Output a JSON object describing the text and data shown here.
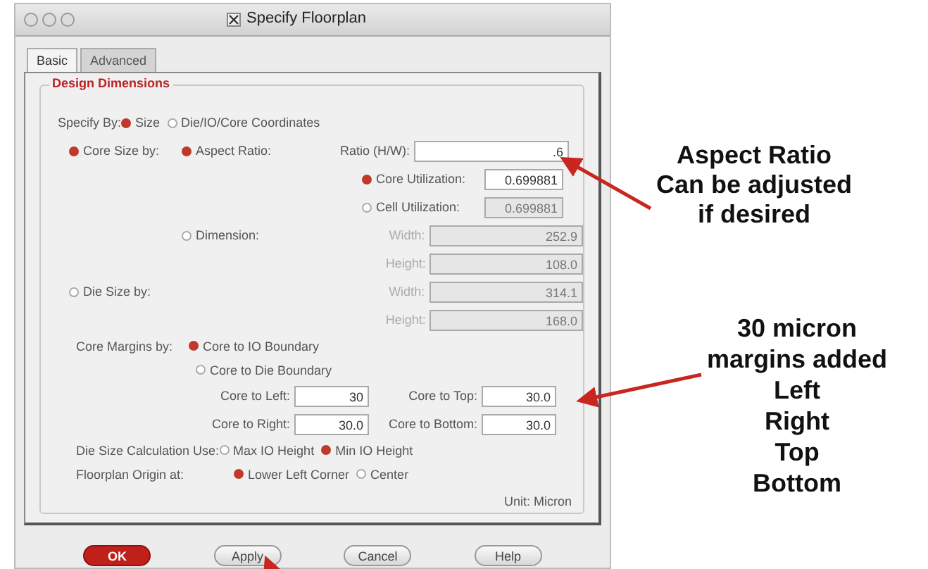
{
  "window": {
    "title": "Specify Floorplan"
  },
  "tabs": [
    {
      "label": "Basic",
      "selected": true
    },
    {
      "label": "Advanced",
      "selected": false
    }
  ],
  "group_title": "Design Dimensions",
  "specify_by": {
    "label": "Specify By:",
    "options": [
      {
        "label": "Size",
        "selected": true
      },
      {
        "label": "Die/IO/Core Coordinates",
        "selected": false
      }
    ]
  },
  "size_modes": [
    {
      "label": "Core Size by:",
      "selected": true
    },
    {
      "label": "Die Size by:",
      "selected": false
    }
  ],
  "core_modes": [
    {
      "label": "Aspect Ratio:",
      "selected": true
    },
    {
      "label": "Dimension:",
      "selected": false
    }
  ],
  "ratio": {
    "label": "Ratio (H/W):",
    "value": ".6"
  },
  "utilization": [
    {
      "label": "Core Utilization:",
      "value": "0.699881",
      "selected": true,
      "disabled": false
    },
    {
      "label": "Cell Utilization:",
      "value": "0.699881",
      "selected": false,
      "disabled": true
    }
  ],
  "core_dims": [
    {
      "label": "Width:",
      "value": "252.9",
      "disabled": true
    },
    {
      "label": "Height:",
      "value": "108.0",
      "disabled": true
    }
  ],
  "die_dims": [
    {
      "label": "Width:",
      "value": "314.1",
      "disabled": true
    },
    {
      "label": "Height:",
      "value": "168.0",
      "disabled": true
    }
  ],
  "core_margins": {
    "label": "Core Margins by:",
    "options": [
      {
        "label": "Core to IO Boundary",
        "selected": true
      },
      {
        "label": "Core to Die Boundary",
        "selected": false
      }
    ]
  },
  "margins": [
    {
      "label": "Core to Left:",
      "value": "30"
    },
    {
      "label": "Core to Top:",
      "value": "30.0"
    },
    {
      "label": "Core to Right:",
      "value": "30.0"
    },
    {
      "label": "Core to Bottom:",
      "value": "30.0"
    }
  ],
  "die_calc": {
    "label": "Die Size Calculation Use:",
    "options": [
      {
        "label": "Max IO Height",
        "selected": false
      },
      {
        "label": "Min IO Height",
        "selected": true
      }
    ]
  },
  "origin": {
    "label": "Floorplan Origin at:",
    "options": [
      {
        "label": "Lower Left Corner",
        "selected": true
      },
      {
        "label": "Center",
        "selected": false
      }
    ]
  },
  "unit": "Unit: Micron",
  "buttons": [
    {
      "label": "OK",
      "kind": "default"
    },
    {
      "label": "Apply",
      "kind": "normal"
    },
    {
      "label": "Cancel",
      "kind": "normal"
    },
    {
      "label": "Help",
      "kind": "normal"
    }
  ],
  "annotations": [
    {
      "lines": [
        "Aspect Ratio",
        "Can be adjusted",
        "if desired"
      ]
    },
    {
      "lines": [
        "30 micron",
        "margins added",
        "Left",
        "Right",
        "Top",
        "Bottom"
      ]
    }
  ]
}
